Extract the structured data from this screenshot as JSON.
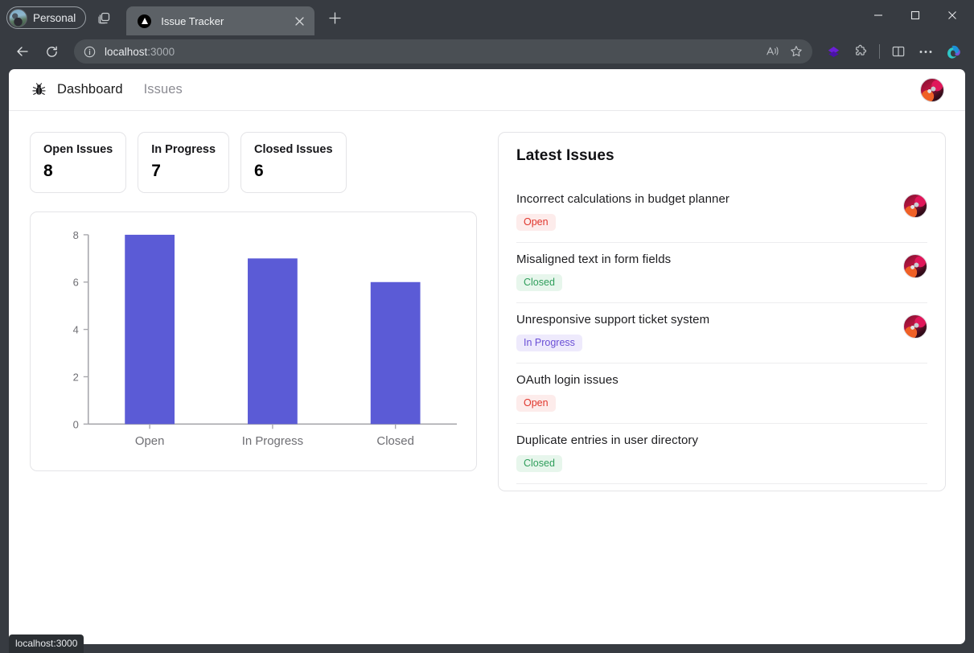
{
  "browser": {
    "profile": {
      "label": "Personal",
      "icon": "profile-avatar-icon"
    },
    "tab_groups_icon": "tab-groups-icon",
    "tab": {
      "title": "Issue Tracker",
      "favicon": "nextjs-triangle-favicon",
      "close_icon": "close-icon"
    },
    "new_tab_icon": "plus-icon",
    "window_controls": {
      "minimize": "minimize-icon",
      "maximize": "maximize-icon",
      "close": "close-icon"
    },
    "nav": {
      "back_icon": "back-arrow-icon",
      "refresh_icon": "refresh-icon"
    },
    "omnibox": {
      "info_icon": "info-circle-icon",
      "url_host": "localhost",
      "url_port": ":3000",
      "read_aloud_icon": "read-aloud-icon",
      "favorite_icon": "star-icon"
    },
    "toolbar": {
      "collections_icon": "diamond-collections-icon",
      "extensions_icon": "puzzle-extensions-icon",
      "split_screen_icon": "split-screen-icon",
      "more_icon": "ellipsis-more-icon",
      "copilot_icon": "copilot-icon"
    },
    "status_bubble": "localhost:3000"
  },
  "app": {
    "brand_icon": "bug-icon",
    "nav": [
      {
        "label": "Dashboard",
        "active": true
      },
      {
        "label": "Issues",
        "active": false
      }
    ],
    "avatar": "user-avatar"
  },
  "stats": [
    {
      "label": "Open Issues",
      "value": "8"
    },
    {
      "label": "In Progress",
      "value": "7"
    },
    {
      "label": "Closed Issues",
      "value": "6"
    }
  ],
  "issues_panel": {
    "title": "Latest Issues",
    "rows": [
      {
        "title": "Incorrect calculations in budget planner",
        "status": "Open",
        "status_key": "open",
        "avatar": "user-avatar"
      },
      {
        "title": "Misaligned text in form fields",
        "status": "Closed",
        "status_key": "closed",
        "avatar": "user-avatar"
      },
      {
        "title": "Unresponsive support ticket system",
        "status": "In Progress",
        "status_key": "progress",
        "avatar": "user-avatar"
      },
      {
        "title": "OAuth login issues",
        "status": "Open",
        "status_key": "open",
        "avatar": ""
      },
      {
        "title": "Duplicate entries in user directory",
        "status": "Closed",
        "status_key": "closed",
        "avatar": ""
      }
    ]
  },
  "chart_data": {
    "type": "bar",
    "title": "",
    "xlabel": "",
    "ylabel": "",
    "categories": [
      "Open",
      "In Progress",
      "Closed"
    ],
    "values": [
      8,
      7,
      6
    ],
    "ylim": [
      0,
      8
    ],
    "yticks": [
      0,
      2,
      4,
      6,
      8
    ],
    "grid": false,
    "legend": false,
    "bar_color": "#5b5bd6",
    "axis_color": "#a8a8ad",
    "tick_label_color": "#6e6e73"
  },
  "colors": {
    "accent_purple": "#5b5bd6",
    "badge_open_bg": "#fdeceb",
    "badge_open_fg": "#e0362c",
    "badge_closed_bg": "#e7f6ec",
    "badge_closed_fg": "#2f9e5b",
    "badge_progress_bg": "#eeeafc",
    "badge_progress_fg": "#6a4fd6",
    "chrome_bg": "#373b41",
    "card_border": "#e4e4e7"
  }
}
